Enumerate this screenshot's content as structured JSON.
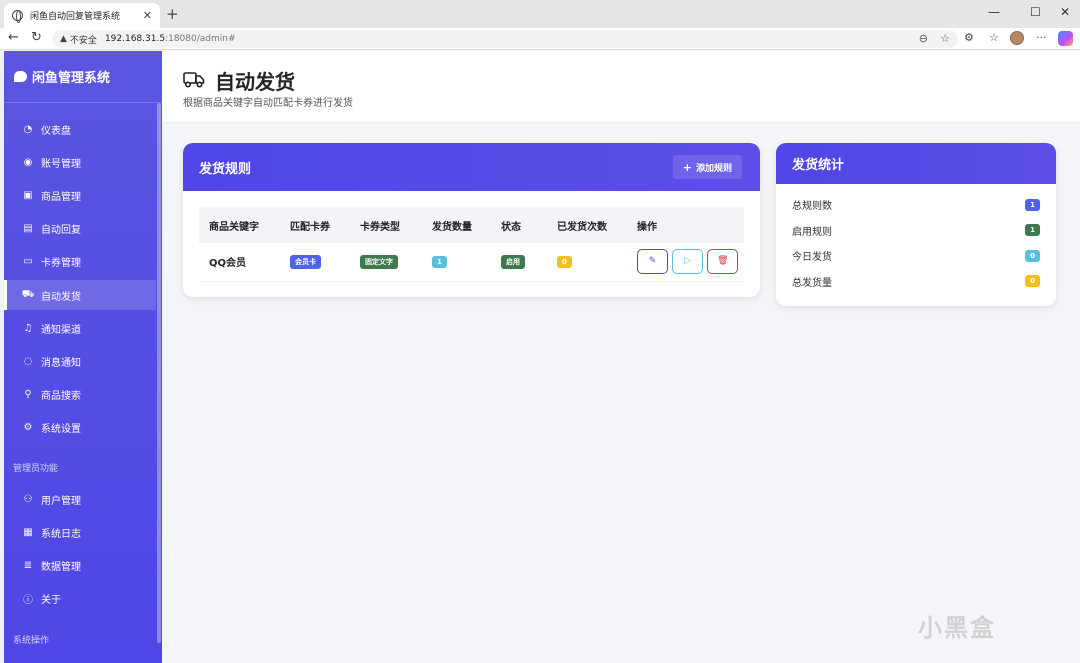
{
  "browser": {
    "tab_title": "闲鱼自动回复管理系统",
    "insecure_label": "不安全",
    "url_host": "192.168.31.5",
    "url_rest": ":18080/admin#"
  },
  "sidebar": {
    "brand": "闲鱼管理系统",
    "items": [
      {
        "label": "仪表盘",
        "icon": "dashboard-icon"
      },
      {
        "label": "账号管理",
        "icon": "user-circle-icon"
      },
      {
        "label": "商品管理",
        "icon": "box-icon"
      },
      {
        "label": "自动回复",
        "icon": "chat-icon"
      },
      {
        "label": "卡券管理",
        "icon": "card-icon"
      },
      {
        "label": "自动发货",
        "icon": "truck-icon"
      },
      {
        "label": "通知渠道",
        "icon": "bell-icon"
      },
      {
        "label": "消息通知",
        "icon": "message-icon"
      },
      {
        "label": "商品搜索",
        "icon": "search-icon"
      },
      {
        "label": "系统设置",
        "icon": "gear-icon"
      }
    ],
    "admin_section": "管理员功能",
    "admin_items": [
      {
        "label": "用户管理",
        "icon": "users-icon"
      },
      {
        "label": "系统日志",
        "icon": "log-icon"
      },
      {
        "label": "数据管理",
        "icon": "database-icon"
      },
      {
        "label": "关于",
        "icon": "info-icon"
      }
    ],
    "system_section": "系统操作"
  },
  "header": {
    "title": "自动发货",
    "subtitle": "根据商品关键字自动匹配卡券进行发货"
  },
  "rules_card": {
    "title": "发货规则",
    "add_button": "添加规则",
    "columns": [
      "商品关键字",
      "匹配卡券",
      "卡券类型",
      "发货数量",
      "状态",
      "已发货次数",
      "操作"
    ],
    "rows": [
      {
        "keyword": "QQ会员",
        "card": "会员卡",
        "card_type": "固定文字",
        "quantity": "1",
        "status": "启用",
        "delivered": "0"
      }
    ]
  },
  "stats_card": {
    "title": "发货统计",
    "items": [
      {
        "label": "总规则数",
        "value": "1",
        "color": "#4f63e8"
      },
      {
        "label": "启用规则",
        "value": "1",
        "color": "#3f7a4f"
      },
      {
        "label": "今日发货",
        "value": "0",
        "color": "#5bc0de"
      },
      {
        "label": "总发货量",
        "value": "0",
        "color": "#f0c020"
      }
    ]
  },
  "colors": {
    "primary": "#4f46e5",
    "blue_badge": "#4f63e8",
    "green_badge": "#3f7a4f",
    "cyan_badge": "#5bc0de",
    "yellow_badge": "#f0c020",
    "danger": "#dc3545"
  },
  "watermark": "小黑盒"
}
